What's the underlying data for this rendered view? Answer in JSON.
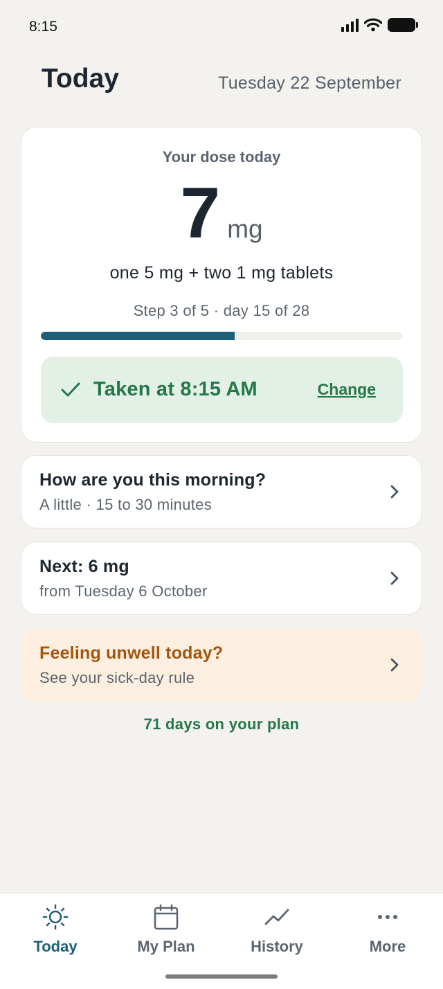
{
  "status_bar": {
    "time": "8:15"
  },
  "header": {
    "title": "Today",
    "date": "Tuesday 22 September"
  },
  "dose_card": {
    "label": "Your dose today",
    "dose_value": "7",
    "dose_unit": "mg",
    "tablets": "one 5 mg + two 1 mg tablets",
    "step_text": "Step 3 of 5 · day 15 of 28",
    "progress_fraction": 0.536,
    "taken_text": "Taken at 8:15 AM",
    "change_label": "Change"
  },
  "cards": [
    {
      "title": "How are you this morning?",
      "subtitle": "A little · 15 to 30 minutes"
    },
    {
      "title": "Next: 6 mg",
      "subtitle": "from Tuesday 6 October"
    },
    {
      "title": "Feeling unwell today?",
      "subtitle": "See your sick-day rule"
    }
  ],
  "plan_days": "71 days on your plan",
  "tabs": [
    {
      "label": "Today",
      "icon": "sun-icon",
      "active": true
    },
    {
      "label": "My Plan",
      "icon": "calendar-icon",
      "active": false
    },
    {
      "label": "History",
      "icon": "trend-icon",
      "active": false
    },
    {
      "label": "More",
      "icon": "more-dots-icon",
      "active": false
    }
  ],
  "colors": {
    "background": "#f3f2ef",
    "accent": "#1d5f78",
    "success": "#25784a",
    "success_bg": "#e2f0e6",
    "warning": "#a0560f",
    "warning_bg": "#fcefe0"
  }
}
